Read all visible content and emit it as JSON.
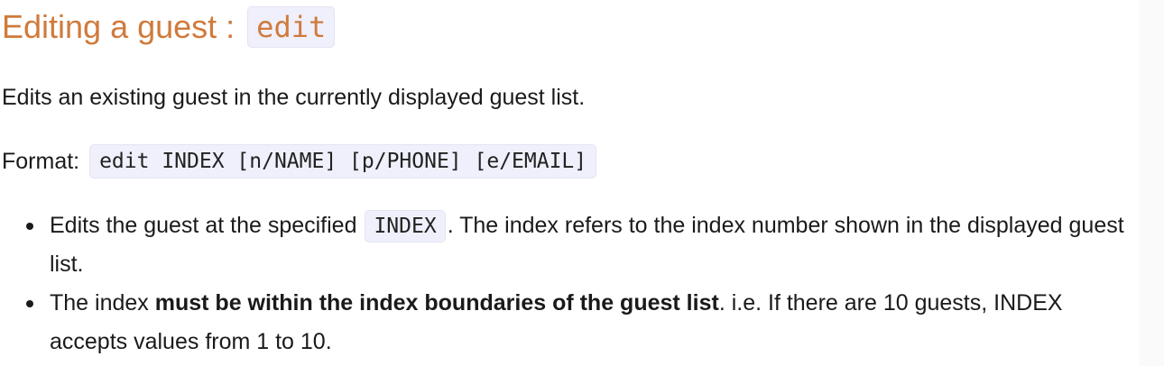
{
  "heading": {
    "text": "Editing a guest : ",
    "command": "edit"
  },
  "description": "Edits an existing guest in the currently displayed guest list.",
  "format": {
    "label": "Format: ",
    "syntax": "edit INDEX [n/NAME] [p/PHONE] [e/EMAIL]"
  },
  "bullets": [
    {
      "before": "Edits the guest at the specified ",
      "code": "INDEX",
      "after": ". The index refers to the index number shown in the displayed guest list."
    },
    {
      "before": "The index ",
      "bold": "must be within the index boundaries of the guest list",
      "after": ". i.e. If there are 10 guests, INDEX accepts values from 1 to 10."
    }
  ],
  "colors": {
    "heading": "#d07a3c",
    "code_background": "#eff0fb",
    "text": "#1a1a1a"
  }
}
